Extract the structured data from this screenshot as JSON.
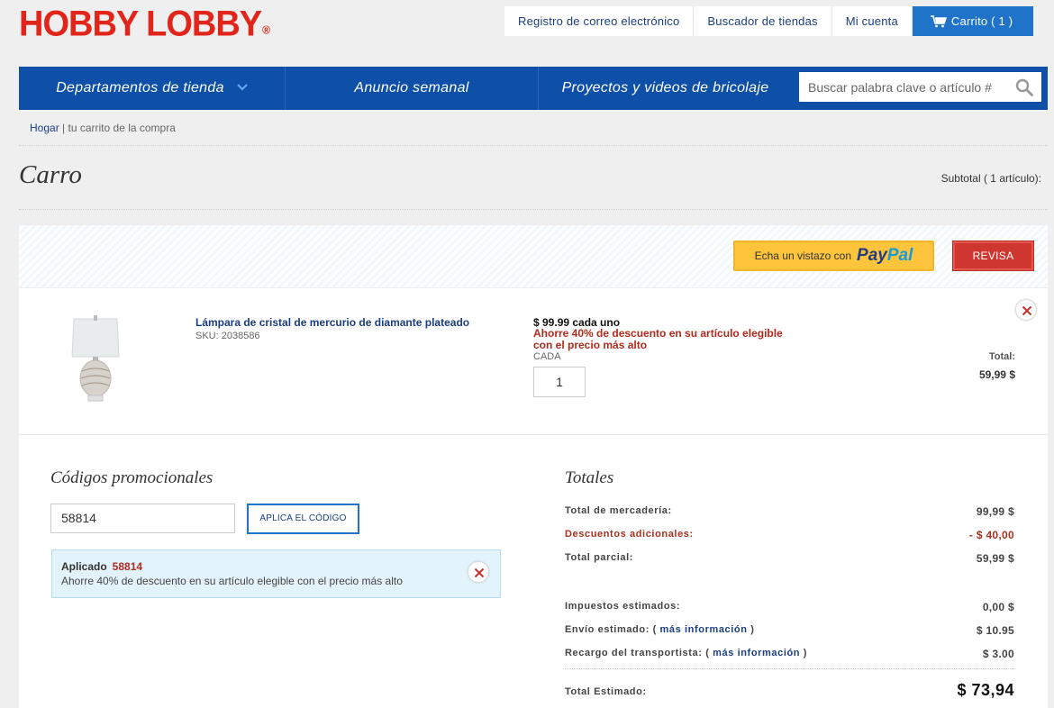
{
  "header": {
    "logo": "HOBBY LOBBY",
    "logo_mark": "®",
    "links": [
      "Registro de correo electrónico",
      "Buscador de tiendas",
      "Mi cuenta"
    ],
    "cart_label": "Carrito ( 1 )"
  },
  "nav": {
    "items": [
      "Departamentos de tienda",
      "Anuncio semanal",
      "Proyectos y videos de bricolaje"
    ],
    "search_placeholder": "Buscar palabra clave o artículo #"
  },
  "breadcrumb": {
    "home": "Hogar",
    "separator": "|",
    "current": "tu carrito de la compra"
  },
  "page": {
    "title": "Carro",
    "subtotal_label": "Subtotal ( 1 artículo):"
  },
  "actions": {
    "paypal_prefix": "Echa un vistazo con",
    "paypal_word1": "Pay",
    "paypal_word2": "Pal",
    "review_label": "REVISA"
  },
  "item": {
    "name": "Lámpara de cristal de mercurio de diamante plateado",
    "sku": "SKU: 2038586",
    "price_each": "$ 99.99 cada uno",
    "promo": "Ahorre 40% de descuento en su artículo elegible con el precio más alto",
    "unit_label": "CADA",
    "quantity": "1",
    "total_label": "Total:",
    "total_value": "59,99 $"
  },
  "promo": {
    "title": "Códigos promocionales",
    "code_value": "58814",
    "apply_label": "APLICA EL CÓDIGO",
    "applied_label": "Aplicado",
    "applied_code": "58814",
    "applied_desc": "Ahorre 40% de descuento en su artículo elegible con el precio más alto"
  },
  "totals": {
    "title": "Totales",
    "merchandise_label": "Total de mercadería:",
    "merchandise_value": "99,99 $",
    "discounts_label": "Descuentos adicionales:",
    "discounts_value": "- $ 40,00",
    "partial_label": "Total parcial:",
    "partial_value": "59,99 $",
    "tax_label": "Impuestos estimados:",
    "tax_value": "0,00 $",
    "shipping_label": "Envío estimado:",
    "shipping_value": "$ 10.95",
    "carrier_label": "Recargo del transportista:",
    "carrier_value": "$ 3.00",
    "more_info": "más información",
    "open_paren": "(",
    "close_paren": ")",
    "estimated_label": "Total Estimado:",
    "estimated_value": "$ 73,94"
  },
  "colors": {
    "brand_red": "#e1251b",
    "nav_blue": "#0e4fa8",
    "cart_blue": "#1f73c9",
    "discount_red": "#a8321f",
    "review_red": "#cf3630",
    "paypal_yellow": "#fdc43c"
  }
}
